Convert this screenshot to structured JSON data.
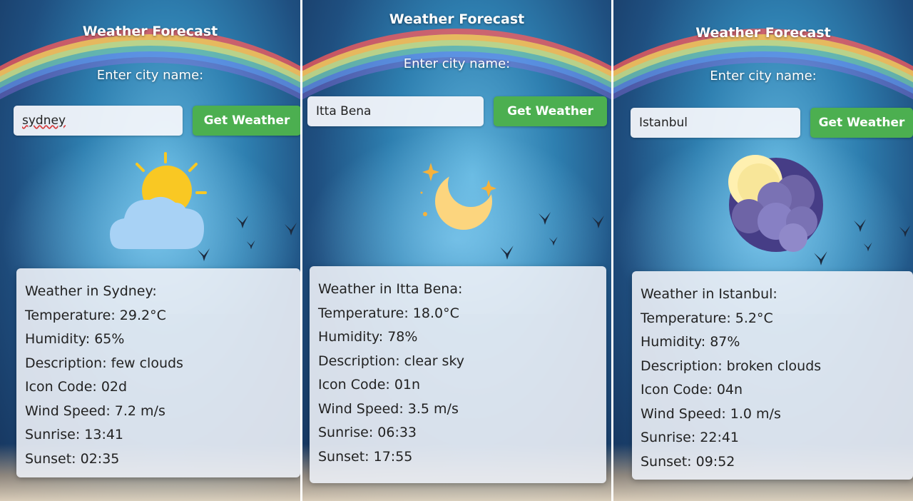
{
  "panels": [
    {
      "title": "Weather Forecast",
      "prompt": "Enter city name:",
      "input_value": "sydney",
      "button_label": "Get Weather",
      "icon": "sun-behind-cloud-icon",
      "result": {
        "heading": "Weather in Sydney:",
        "temperature": "Temperature: 29.2°C",
        "humidity": "Humidity: 65%",
        "description": "Description: few clouds",
        "icon_code": "Icon Code: 02d",
        "wind_speed": "Wind Speed: 7.2 m/s",
        "sunrise": "Sunrise: 13:41",
        "sunset": "Sunset: 02:35"
      }
    },
    {
      "title": "Weather Forecast",
      "prompt": "Enter city name:",
      "input_value": "Itta Bena",
      "button_label": "Get Weather",
      "icon": "crescent-moon-icon",
      "result": {
        "heading": "Weather in Itta Bena:",
        "temperature": "Temperature: 18.0°C",
        "humidity": "Humidity: 78%",
        "description": "Description: clear sky",
        "icon_code": "Icon Code: 01n",
        "wind_speed": "Wind Speed: 3.5 m/s",
        "sunrise": "Sunrise: 06:33",
        "sunset": "Sunset: 17:55"
      }
    },
    {
      "title": "Weather Forecast",
      "prompt": "Enter city name:",
      "input_value": "Istanbul",
      "button_label": "Get Weather",
      "icon": "moon-behind-clouds-icon",
      "result": {
        "heading": "Weather in Istanbul:",
        "temperature": "Temperature: 5.2°C",
        "humidity": "Humidity: 87%",
        "description": "Description: broken clouds",
        "icon_code": "Icon Code: 04n",
        "wind_speed": "Wind Speed: 1.0 m/s",
        "sunrise": "Sunrise: 22:41",
        "sunset": "Sunset: 09:52"
      }
    }
  ],
  "colors": {
    "button": "#4caf50",
    "sun": "#f9c823",
    "cloud": "#a8d2f5",
    "moon": "#fcd57e",
    "night_cloud": "#6e64a6"
  }
}
